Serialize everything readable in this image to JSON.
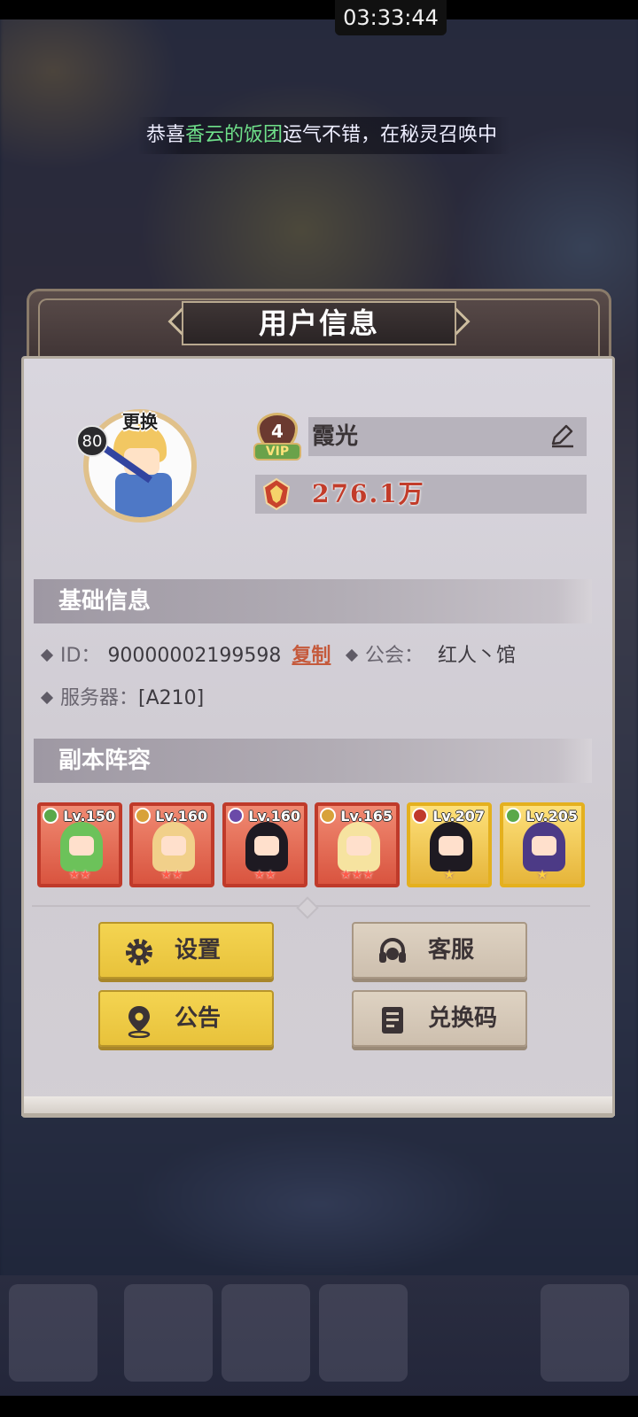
{
  "status_bar": {
    "time": "03:33:44"
  },
  "ticker": {
    "prefix": "恭喜",
    "highlight": "香云的饭团",
    "suffix": "运气不错，在秘灵召唤中"
  },
  "dialog": {
    "title": "用户信息"
  },
  "profile": {
    "change_label": "更换",
    "level": "80",
    "vip_level": "4",
    "vip_label": "VIP",
    "name": "霞光",
    "power": "276.1万"
  },
  "basic_info": {
    "header": "基础信息",
    "id_label": "ID：",
    "id_value": "90000002199598",
    "copy_label": "复制",
    "guild_label": "公会：",
    "guild_value": "红人丶馆",
    "server_label": "服务器：",
    "server_value": "[A210]"
  },
  "lineup": {
    "header": "副本阵容",
    "heroes": [
      {
        "level": "Lv.150",
        "frame": "red",
        "element_color": "#5aa84a",
        "stars": "★★",
        "star_style": "red",
        "hair": "#6cc25a"
      },
      {
        "level": "Lv.160",
        "frame": "red",
        "element_color": "#d8a23a",
        "stars": "★★",
        "star_style": "red",
        "hair": "#f1d08a"
      },
      {
        "level": "Lv.160",
        "frame": "red",
        "element_color": "#6b4aa8",
        "stars": "★★",
        "star_style": "red",
        "hair": "#1e1a22"
      },
      {
        "level": "Lv.165",
        "frame": "red",
        "element_color": "#d8a23a",
        "stars": "★★★",
        "star_style": "red",
        "hair": "#f6e3a0"
      },
      {
        "level": "Lv.207",
        "frame": "gold",
        "element_color": "#c0392b",
        "stars": "★",
        "star_style": "gold",
        "hair": "#1e1a22"
      },
      {
        "level": "Lv.205",
        "frame": "gold",
        "element_color": "#5aa84a",
        "stars": "★",
        "star_style": "gold",
        "hair": "#4c3a86"
      }
    ]
  },
  "buttons": {
    "settings": "设置",
    "support": "客服",
    "notice": "公告",
    "redeem": "兑换码"
  },
  "colors": {
    "accent_yellow": "#f4d451",
    "accent_tan": "#ded2c2",
    "power_red": "#c23c2a",
    "highlight_green": "#6fe08a"
  },
  "icons": {
    "settings": "gear-icon",
    "support": "headset-icon",
    "notice": "location-pin-icon",
    "redeem": "document-icon",
    "edit": "pencil-icon",
    "power": "crest-icon"
  }
}
